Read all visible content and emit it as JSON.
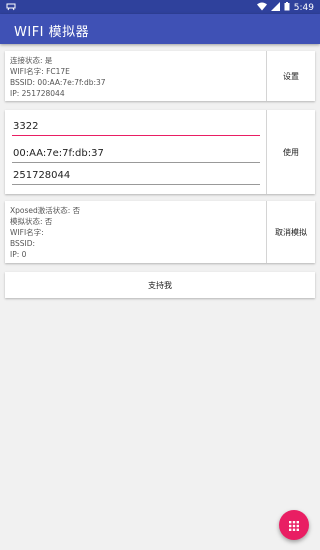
{
  "status_bar": {
    "time": "5:49"
  },
  "app_bar": {
    "title": "WIFI 模拟器"
  },
  "current_card": {
    "lines": [
      "连接状态: 是",
      "WIFI名字: FC17E",
      "BSSID: 00:AA:7e:7f:db:37",
      "IP: 251728044"
    ],
    "action_label": "设置"
  },
  "input_card": {
    "fields": [
      "3322",
      "00:AA:7e:7f:db:37",
      "251728044"
    ],
    "action_label": "使用"
  },
  "xposed_card": {
    "lines": [
      "Xposed激活状态: 否",
      "模拟状态: 否",
      "WIFI名字:",
      "BSSID:",
      "IP: 0"
    ],
    "action_label": "取消模拟"
  },
  "support_button": {
    "label": "支持我"
  },
  "fab": {
    "icon": "grid-icon"
  }
}
